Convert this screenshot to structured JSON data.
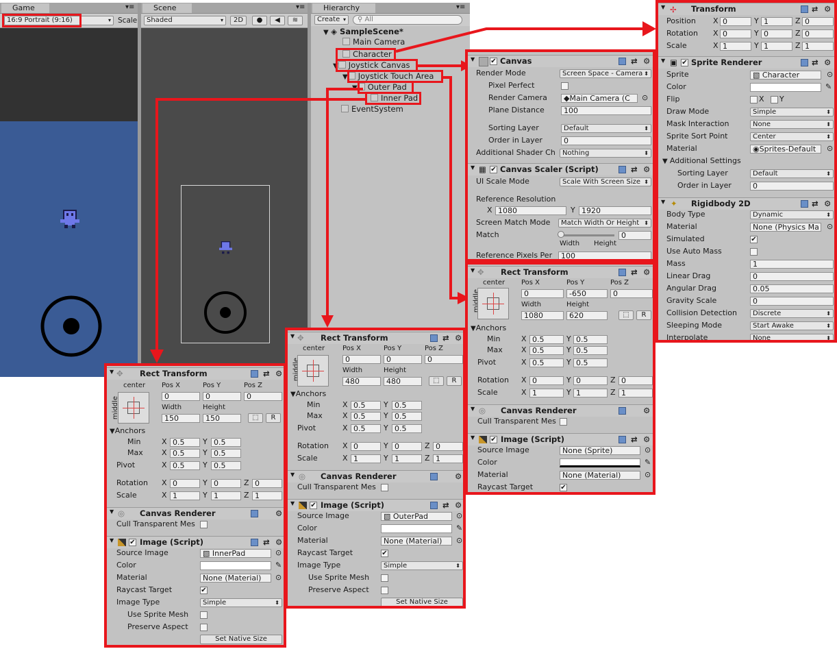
{
  "game": {
    "tab": "Game",
    "aspect": "16:9 Portrait (9:16)",
    "scale": "Scale"
  },
  "scene": {
    "tab": "Scene",
    "shading": "Shaded",
    "mode2d": "2D"
  },
  "hierarchy": {
    "tab": "Hierarchy",
    "create": "Create",
    "search_placeholder": "All",
    "items": [
      "SampleScene*",
      "Main Camera",
      "Character",
      "Joystick Canvas",
      "Joystick Touch Area",
      "Outer Pad",
      "Inner Pad",
      "EventSystem"
    ]
  },
  "character_inspector": {
    "transform": {
      "title": "Transform",
      "position": {
        "label": "Position",
        "x": "0",
        "y": "1",
        "z": "0"
      },
      "rotation": {
        "label": "Rotation",
        "x": "0",
        "y": "0",
        "z": "0"
      },
      "scale": {
        "label": "Scale",
        "x": "1",
        "y": "1",
        "z": "1"
      }
    },
    "sprite_renderer": {
      "title": "Sprite Renderer",
      "sprite_label": "Sprite",
      "sprite": "Character",
      "color_label": "Color",
      "flip_label": "Flip",
      "flip_x": "X",
      "flip_y": "Y",
      "draw_mode_label": "Draw Mode",
      "draw_mode": "Simple",
      "mask_label": "Mask Interaction",
      "mask": "None",
      "sort_point_label": "Sprite Sort Point",
      "sort_point": "Center",
      "material_label": "Material",
      "material": "Sprites-Default",
      "additional": "Additional Settings",
      "sorting_layer_label": "Sorting Layer",
      "sorting_layer": "Default",
      "order_label": "Order in Layer",
      "order": "0"
    },
    "rigidbody": {
      "title": "Rigidbody 2D",
      "body_type_label": "Body Type",
      "body_type": "Dynamic",
      "material_label": "Material",
      "material": "None (Physics Ma",
      "simulated_label": "Simulated",
      "auto_mass_label": "Use Auto Mass",
      "mass_label": "Mass",
      "mass": "1",
      "linear_drag_label": "Linear Drag",
      "linear_drag": "0",
      "angular_drag_label": "Angular Drag",
      "angular_drag": "0.05",
      "gravity_label": "Gravity Scale",
      "gravity": "0",
      "collision_label": "Collision Detection",
      "collision": "Discrete",
      "sleeping_label": "Sleeping Mode",
      "sleeping": "Start Awake",
      "interpolate_label": "Interpolate",
      "interpolate": "None"
    }
  },
  "canvas_inspector": {
    "canvas": {
      "title": "Canvas",
      "render_mode_label": "Render Mode",
      "render_mode": "Screen Space - Camera",
      "pixel_perfect_label": "Pixel Perfect",
      "render_camera_label": "Render Camera",
      "render_camera": "Main Camera (C",
      "plane_distance_label": "Plane Distance",
      "plane_distance": "100",
      "sorting_layer_label": "Sorting Layer",
      "sorting_layer": "Default",
      "order_label": "Order in Layer",
      "order": "0",
      "shader_label": "Additional Shader Ch",
      "shader": "Nothing"
    },
    "scaler": {
      "title": "Canvas Scaler (Script)",
      "ui_scale_label": "UI Scale Mode",
      "ui_scale": "Scale With Screen Size",
      "ref_res_label": "Reference Resolution",
      "ref_x": "1080",
      "ref_y": "1920",
      "match_mode_label": "Screen Match Mode",
      "match_mode": "Match Width Or Height",
      "match_label": "Match",
      "match": "0",
      "width_label": "Width",
      "height_label": "Height",
      "ppu_label": "Reference Pixels Per",
      "ppu": "100"
    }
  },
  "touch_area_inspector": {
    "rect": {
      "title": "Rect Transform",
      "anchor_h": "center",
      "anchor_v": "middle",
      "posx_label": "Pos X",
      "posy_label": "Pos Y",
      "posz_label": "Pos Z",
      "posx": "0",
      "posy": "-650",
      "posz": "0",
      "width_label": "Width",
      "height_label": "Height",
      "width": "1080",
      "height": "620",
      "anchors_label": "Anchors",
      "min_label": "Min",
      "max_label": "Max",
      "pivot_label": "Pivot",
      "min_x": "0.5",
      "min_y": "0.5",
      "max_x": "0.5",
      "max_y": "0.5",
      "pivot_x": "0.5",
      "pivot_y": "0.5",
      "rotation_label": "Rotation",
      "scale_label": "Scale",
      "rot_x": "0",
      "rot_y": "0",
      "rot_z": "0",
      "scale_x": "1",
      "scale_y": "1",
      "scale_z": "1"
    },
    "canvas_renderer": {
      "title": "Canvas Renderer",
      "cull_label": "Cull Transparent Mes"
    },
    "image": {
      "title": "Image (Script)",
      "source_label": "Source Image",
      "source": "None (Sprite)",
      "color_label": "Color",
      "material_label": "Material",
      "material": "None (Material)",
      "raycast_label": "Raycast Target"
    }
  },
  "outer_pad_inspector": {
    "rect": {
      "title": "Rect Transform",
      "anchor_h": "center",
      "anchor_v": "middle",
      "posx_label": "Pos X",
      "posy_label": "Pos Y",
      "posz_label": "Pos Z",
      "posx": "0",
      "posy": "0",
      "posz": "0",
      "width_label": "Width",
      "height_label": "Height",
      "width": "480",
      "height": "480",
      "anchors_label": "Anchors",
      "min_label": "Min",
      "max_label": "Max",
      "pivot_label": "Pivot",
      "min_x": "0.5",
      "min_y": "0.5",
      "max_x": "0.5",
      "max_y": "0.5",
      "pivot_x": "0.5",
      "pivot_y": "0.5",
      "rotation_label": "Rotation",
      "scale_label": "Scale",
      "rot_x": "0",
      "rot_y": "0",
      "rot_z": "0",
      "scale_x": "1",
      "scale_y": "1",
      "scale_z": "1"
    },
    "canvas_renderer": {
      "title": "Canvas Renderer",
      "cull_label": "Cull Transparent Mes"
    },
    "image": {
      "title": "Image (Script)",
      "source_label": "Source Image",
      "source": "OuterPad",
      "color_label": "Color",
      "material_label": "Material",
      "material": "None (Material)",
      "raycast_label": "Raycast Target",
      "type_label": "Image Type",
      "type": "Simple",
      "sprite_mesh_label": "Use Sprite Mesh",
      "preserve_label": "Preserve Aspect",
      "native_size": "Set Native Size"
    }
  },
  "inner_pad_inspector": {
    "rect": {
      "title": "Rect Transform",
      "anchor_h": "center",
      "anchor_v": "middle",
      "posx_label": "Pos X",
      "posy_label": "Pos Y",
      "posz_label": "Pos Z",
      "posx": "0",
      "posy": "0",
      "posz": "0",
      "width_label": "Width",
      "height_label": "Height",
      "width": "150",
      "height": "150",
      "anchors_label": "Anchors",
      "min_label": "Min",
      "max_label": "Max",
      "pivot_label": "Pivot",
      "min_x": "0.5",
      "min_y": "0.5",
      "max_x": "0.5",
      "max_y": "0.5",
      "pivot_x": "0.5",
      "pivot_y": "0.5",
      "rotation_label": "Rotation",
      "scale_label": "Scale",
      "rot_x": "0",
      "rot_y": "0",
      "rot_z": "0",
      "scale_x": "1",
      "scale_y": "1",
      "scale_z": "1"
    },
    "canvas_renderer": {
      "title": "Canvas Renderer",
      "cull_label": "Cull Transparent Mes"
    },
    "image": {
      "title": "Image (Script)",
      "source_label": "Source Image",
      "source": "InnerPad",
      "color_label": "Color",
      "material_label": "Material",
      "material": "None (Material)",
      "raycast_label": "Raycast Target",
      "type_label": "Image Type",
      "type": "Simple",
      "sprite_mesh_label": "Use Sprite Mesh",
      "preserve_label": "Preserve Aspect",
      "native_size": "Set Native Size"
    }
  },
  "colors": {
    "highlight": "#e8161c",
    "game_bg": "#3a5b95",
    "scene_bg": "#4a4a4a",
    "panel_bg": "#c2c2c2"
  },
  "icons": {
    "transform": "transform-icon",
    "sprite_renderer": "sprite-renderer-icon",
    "rigidbody": "rigidbody-icon",
    "canvas": "canvas-icon",
    "scaler": "canvas-scaler-icon",
    "rect": "rect-transform-icon",
    "renderer": "canvas-renderer-icon",
    "image": "image-icon"
  }
}
